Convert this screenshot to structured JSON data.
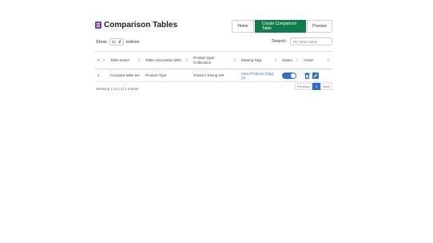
{
  "header": {
    "title": "Comparison Tables",
    "buttons": {
      "home": "Home",
      "create": "Create Comparison Table",
      "preview": "Preview"
    }
  },
  "controls": {
    "show_label": "Show",
    "entries_value": "10",
    "entries_label": "entries",
    "search_label": "Search:",
    "search_placeholder": "By Table Name"
  },
  "table": {
    "columns": [
      "#",
      "Table Name",
      "Table Association With",
      "Product type/ Collections",
      "Missing Tags",
      "Status",
      "Action"
    ],
    "rows": [
      {
        "index": "1",
        "table_name": "Compare table tes",
        "association": "Product Type",
        "collections": "Outdoor Dining Set",
        "missing_tags": "View Products (Tag) (1)",
        "status": "on"
      }
    ]
  },
  "footer": {
    "info": "Showing 1 to 1 of 1 entries",
    "pager": {
      "prev": "Previous",
      "current": "1",
      "next": "Next"
    }
  },
  "colors": {
    "primary_green": "#0f7c4f",
    "accent_blue": "#2a6fc9",
    "title_icon": "#6f42c1"
  },
  "icons": {
    "title": "table-list-icon",
    "delete": "trash-icon",
    "edit": "pencil-icon",
    "sort": "sort-arrows-icon"
  }
}
